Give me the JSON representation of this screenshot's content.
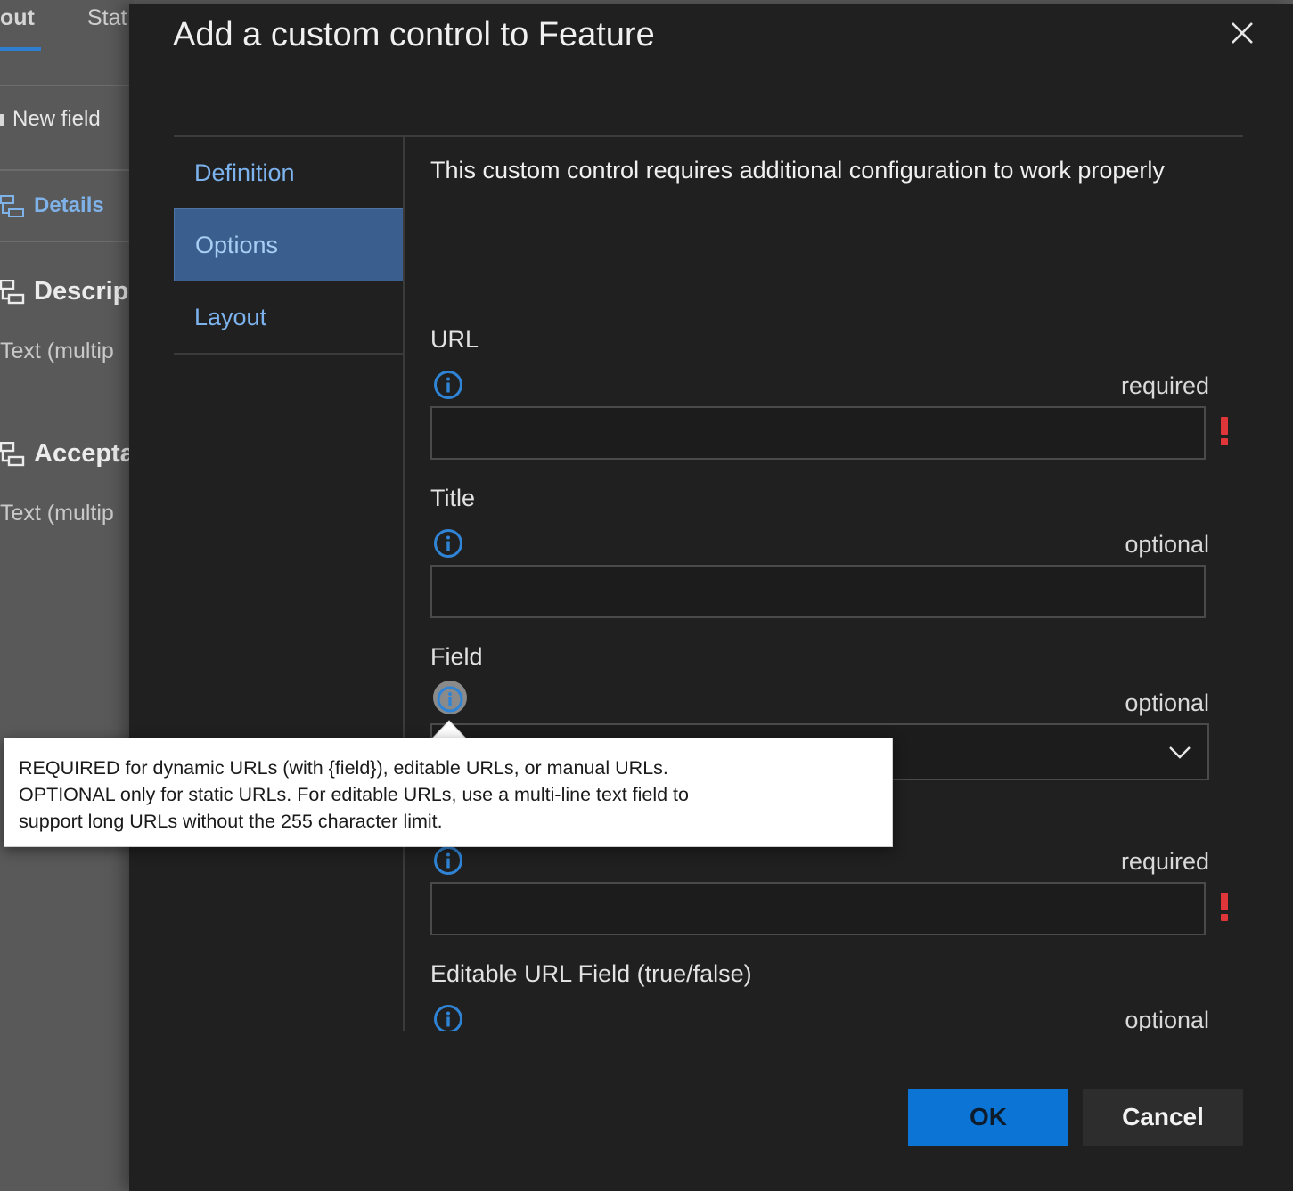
{
  "background": {
    "tabs": [
      "out",
      "Stat"
    ],
    "new_field": "New field",
    "details": "Details",
    "groups": [
      {
        "title": "Descrip",
        "subtitle": "Text (multip"
      },
      {
        "title": "Accepta",
        "subtitle": "Text (multip"
      }
    ]
  },
  "dialog": {
    "title": "Add a custom control to Feature",
    "close_icon": "close-icon",
    "nav": [
      "Definition",
      "Options",
      "Layout"
    ],
    "active_nav": "Options",
    "notice": "This custom control requires additional configuration to work properly",
    "fields": [
      {
        "label": "URL",
        "requirement": "required",
        "type": "text",
        "value": "",
        "error": true
      },
      {
        "label": "Title",
        "requirement": "optional",
        "type": "text",
        "value": "",
        "error": false
      },
      {
        "label": "Field",
        "requirement": "optional",
        "type": "select",
        "value": "",
        "error": false
      },
      {
        "label": "",
        "requirement": "required",
        "type": "text",
        "value": "",
        "error": true
      },
      {
        "label": "Editable URL Field (true/false)",
        "requirement": "optional",
        "type": "text",
        "value": "",
        "error": false
      }
    ],
    "buttons": {
      "ok": "OK",
      "cancel": "Cancel"
    },
    "colors": {
      "accent": "#0b74d5",
      "error": "#e0363a",
      "info": "#2f84d6",
      "nav_active": "#3a5f8f"
    }
  },
  "tooltip": {
    "lines": [
      "REQUIRED for dynamic URLs (with {field}), editable URLs, or manual URLs.",
      "OPTIONAL only for static URLs. For editable URLs, use a multi-line text field to",
      "support long URLs without the 255 character limit."
    ]
  }
}
